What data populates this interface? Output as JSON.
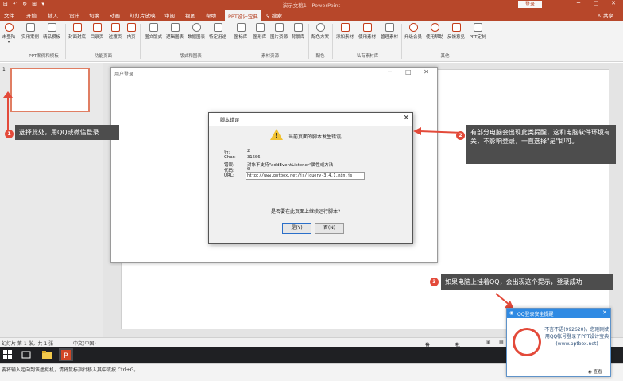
{
  "titlebar": {
    "quick_access": "⊟ ↶ ↻ ⊞ ▾",
    "title": "演示文稿1 - PowerPoint",
    "login": "登录",
    "minimize": "─",
    "restore": "□",
    "close": "✕"
  },
  "tabs": [
    "文件",
    "开始",
    "插入",
    "设计",
    "切换",
    "动画",
    "幻灯片放映",
    "审阅",
    "视图",
    "帮助",
    "PPT设计宝典",
    "搜索"
  ],
  "active_tab": "PPT设计宝典",
  "share_label": "共享",
  "ribbon": {
    "buttons": {
      "login": "未登陆",
      "cases": "实用案例",
      "templates": "精品模板",
      "cover": "封面封底",
      "toc": "目录页",
      "transition": "过渡页",
      "content": "内页",
      "text_layout": "图文版式",
      "logic": "逻辑图表",
      "data": "数据图表",
      "special": "特定用途",
      "icon_lib": "图标库",
      "pic_lib": "图形库",
      "pic_res": "图片资源",
      "bg_lib": "背景库",
      "color": "配色方案",
      "add_mat": "添加素材",
      "use_mat": "使用素材",
      "manage_mat": "管理素材",
      "upgrade": "升级会员",
      "help": "使用帮助",
      "feedback": "反馈意见",
      "custom": "PPT定制"
    },
    "groups": {
      "cases": "PPT案例和模板",
      "pages": "功能页面",
      "layout": "版式和图表",
      "resources": "素材资源",
      "color": "配色",
      "private": "私有素材库",
      "other": "其他"
    }
  },
  "thumb_number": "1",
  "login_window": {
    "title": "用户登录",
    "minimize": "─",
    "maximize": "□",
    "close": "✕"
  },
  "error_dialog": {
    "title": "脚本错误",
    "close": "✕",
    "heading": "当前页面的脚本发生错误。",
    "fields": [
      {
        "label": "行:",
        "value": "2"
      },
      {
        "label": "Char:",
        "value": "31606"
      },
      {
        "label": "错误:",
        "value": "对象不支持\"addEventListener\"属性或方法"
      },
      {
        "label": "代码:",
        "value": "0"
      },
      {
        "label": "URL:",
        "value": "http://www.pptbox.net/js/jquery-3.4.1.min.js"
      }
    ],
    "question": "是否要在此页面上继续运行脚本?",
    "yes": "是(Y)",
    "no": "否(N)"
  },
  "callouts": [
    {
      "num": "1",
      "text": "选择此处，用QQ或微信登录"
    },
    {
      "num": "2",
      "text": "有部分电脑会出现此类提醒，这和电脑软件环境有关，不影响登录，一直选择\"是\"即可。"
    },
    {
      "num": "3",
      "text": "如果电脑上挂着QQ，会出现这个提示，登录成功"
    }
  ],
  "statusbar": {
    "slide_info": "幻灯片 第 1 张，共 1 张",
    "language": "中文(中国)",
    "notes": "备注",
    "comments": "批注"
  },
  "promptbar": {
    "text": "要将输入定向到该虚拟机，请将鼠标指针移入其中或按 Ctrl+G。"
  },
  "qq_popup": {
    "title": "QQ登录安全提醒",
    "close": "✕",
    "message": "不言不语(992620)，您刚刚使用QQ帐号登录了PPT设计宝典(www.pptbox.net)",
    "view": "查看"
  },
  "colors": {
    "brand": "#b7472a",
    "callout_bg": "#4d4d4d",
    "badge": "#e34a3a",
    "qq_blue": "#2f8ae3"
  }
}
